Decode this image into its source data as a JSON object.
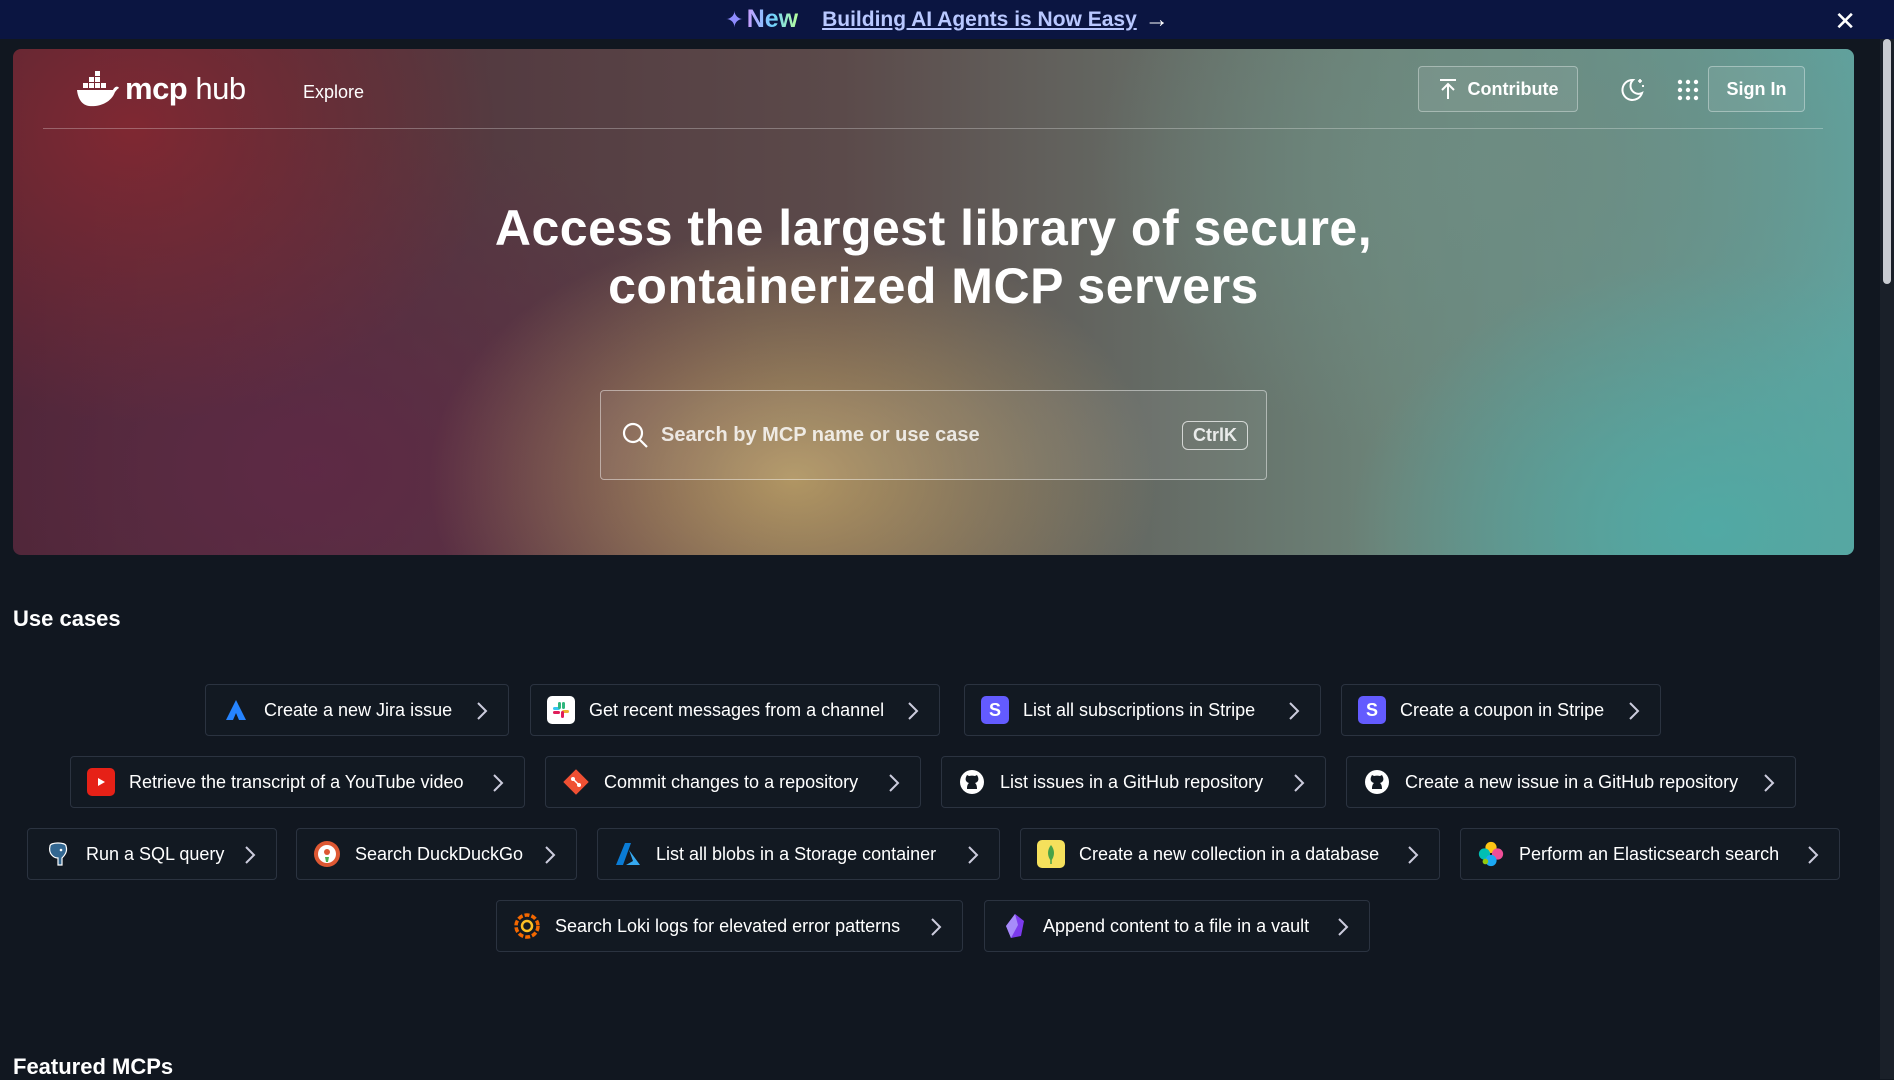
{
  "banner": {
    "new_label": "New",
    "link_text": "Building AI Agents is Now Easy",
    "arrow": "→",
    "close": "✕"
  },
  "nav": {
    "logo_bold": "mcp",
    "logo_rest": " hub",
    "explore": "Explore",
    "contribute": "Contribute",
    "sign_in": "Sign In"
  },
  "hero": {
    "title_line1": "Access the largest library of secure,",
    "title_line2": "containerized MCP servers",
    "search_placeholder": "Search by MCP name or use case",
    "shortcut": "CtrlK"
  },
  "use_cases": {
    "title": "Use cases",
    "rows": [
      [
        {
          "label": "Create a new Jira issue",
          "icon": "jira-icon"
        },
        {
          "label": "Get recent messages from a channel",
          "icon": "slack-icon"
        },
        {
          "label": "List all subscriptions in Stripe",
          "icon": "stripe-icon"
        },
        {
          "label": "Create a coupon in Stripe",
          "icon": "stripe-icon"
        }
      ],
      [
        {
          "label": "Retrieve the transcript of a YouTube video",
          "icon": "youtube-icon"
        },
        {
          "label": "Commit changes to a repository",
          "icon": "git-icon"
        },
        {
          "label": "List issues in a GitHub repository",
          "icon": "github-icon"
        },
        {
          "label": "Create a new issue in a GitHub repository",
          "icon": "github-icon"
        }
      ],
      [
        {
          "label": "Run a SQL query",
          "icon": "postgres-icon"
        },
        {
          "label": "Search DuckDuckGo",
          "icon": "duckduckgo-icon"
        },
        {
          "label": "List all blobs in a Storage container",
          "icon": "azure-icon"
        },
        {
          "label": "Create a new collection in a database",
          "icon": "mongodb-icon"
        },
        {
          "label": "Perform an Elasticsearch search",
          "icon": "elasticsearch-icon"
        }
      ],
      [
        {
          "label": "Search Loki logs for elevated error patterns",
          "icon": "grafana-icon"
        },
        {
          "label": "Append content to a file in a vault",
          "icon": "obsidian-icon"
        }
      ]
    ]
  },
  "featured": {
    "title": "Featured MCPs"
  },
  "colors": {
    "banner_bg": "#0b1541",
    "page_bg": "#111720",
    "chip_border": "#2b3340",
    "stripe": "#635bff",
    "youtube": "#e62117",
    "git": "#f05033"
  }
}
